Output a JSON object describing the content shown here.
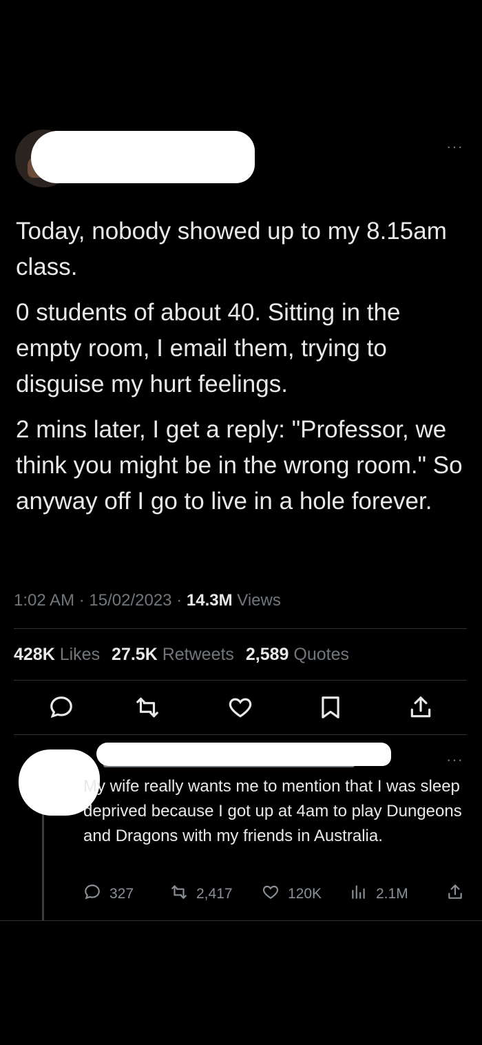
{
  "tweet": {
    "paragraphs": [
      "Today, nobody showed up to my 8.15am class.",
      "0 students of about 40.  Sitting in the empty room, I email them, trying to disguise my hurt feelings.",
      "2 mins later, I get a reply: \"Professor, we think you might be in the wrong room.\" So anyway off I go to live in a hole forever."
    ],
    "time": "1:02 AM",
    "separator": "·",
    "date": "15/02/2023",
    "views_count": "14.3M",
    "views_label": "Views",
    "likes_count": "428K",
    "likes_label": "Likes",
    "retweets_count": "27.5K",
    "retweets_label": "Retweets",
    "quotes_count": "2,589",
    "quotes_label": "Quotes",
    "more_menu": "···",
    "actions": [
      "reply-icon",
      "retweet-icon",
      "like-icon",
      "bookmark-icon",
      "share-icon"
    ]
  },
  "reply": {
    "text": "My wife really wants me to mention that I was sleep deprived because I got up at 4am to play Dungeons and Dragons with my friends in Australia.",
    "more_menu": "···",
    "replies": "327",
    "retweets": "2,417",
    "likes": "120K",
    "views": "2.1M"
  },
  "colors": {
    "background": "#000000",
    "text": "#e7e9ea",
    "secondary": "#71767b",
    "divider": "#2f3336"
  }
}
